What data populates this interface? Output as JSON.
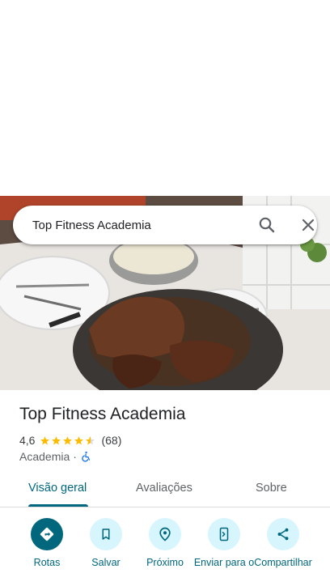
{
  "search": {
    "query": "Top Fitness Academia"
  },
  "place": {
    "name": "Top Fitness Academia",
    "rating": "4,6",
    "rating_fraction": 0.92,
    "reviews": "(68)",
    "category": "Academia",
    "separator": "·"
  },
  "tabs": [
    {
      "label": "Visão geral",
      "active": true
    },
    {
      "label": "Avaliações",
      "active": false
    },
    {
      "label": "Sobre",
      "active": false
    }
  ],
  "actions": [
    {
      "label": "Rotas",
      "icon": "directions-icon"
    },
    {
      "label": "Salvar",
      "icon": "bookmark-icon"
    },
    {
      "label": "Próximo",
      "icon": "nearby-icon"
    },
    {
      "label": "Enviar para o",
      "icon": "send-to-phone-icon"
    },
    {
      "label": "Compartilhar",
      "icon": "share-icon"
    }
  ],
  "colors": {
    "accent": "#00677d",
    "accent_light": "#d6f5fd",
    "star": "#fbbc04",
    "accessibility": "#1a73e8"
  }
}
